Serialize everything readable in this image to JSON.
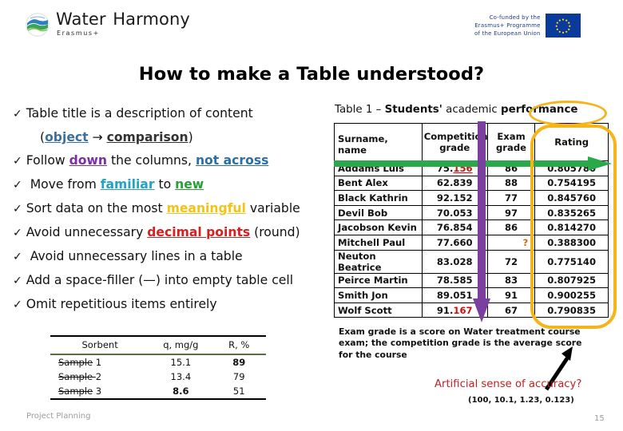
{
  "header": {
    "logo_title_a": "Water",
    "logo_title_b": "Harmony",
    "logo_subtitle": "Erasmus+",
    "eu_line1": "Co-funded by the",
    "eu_line2": "Erasmus+ Programme",
    "eu_line3": "of the European Union"
  },
  "slide": {
    "title": "How to make a Table understood?",
    "footer_label": "Project Planning",
    "page_number": "15"
  },
  "bullets": [
    {
      "check": "✓",
      "pre": "Table title is a description of content"
    },
    {
      "check": "",
      "indent": true,
      "pre": "(",
      "hl1": "object",
      "mid": " → ",
      "hl2": "comparison",
      "post": ")"
    },
    {
      "check": "✓",
      "pre": "Follow ",
      "hl1": "down",
      "mid": " the columns, ",
      "hl2": "not across",
      "post": ""
    },
    {
      "check": "✓",
      "pre": " Move from ",
      "hl1": "familiar",
      "mid": " to ",
      "hl2": "new",
      "post": ""
    },
    {
      "check": "✓",
      "pre": "Sort data on the most ",
      "hl1": "meaningful",
      "mid": "",
      "hl2": "",
      "post": " variable"
    },
    {
      "check": "✓",
      "pre": "Avoid unnecessary ",
      "hl1": "decimal points",
      "mid": "",
      "hl2": "",
      "post": " (round)"
    },
    {
      "check": "✓",
      "pre": " Avoid unnecessary lines in a table"
    },
    {
      "check": "✓",
      "pre": "Add a space-filler (—) into empty table cell"
    },
    {
      "check": "✓",
      "pre": "Omit repetitious items entirely"
    }
  ],
  "mini_table": {
    "columns": [
      "Sorbent",
      "q, mg/g",
      "R, %"
    ],
    "rows": [
      {
        "name_strike": "Sample",
        "name_rest": " 1",
        "q": "15.1",
        "r": "89",
        "q_bold": false,
        "r_bold": true
      },
      {
        "name_strike": "Sample ",
        "name_rest": "2",
        "q": "13.4",
        "r": "79",
        "q_bold": false,
        "r_bold": false
      },
      {
        "name_strike": "Sample",
        "name_rest": " 3",
        "q": "8.6",
        "r": "51",
        "q_bold": true,
        "r_bold": false
      }
    ]
  },
  "main_table": {
    "title_prefix": "Table 1 – ",
    "title_bold": "Students'",
    "title_mid": " academic ",
    "title_circled": "performance",
    "columns": [
      "Surname, name",
      "Competition grade",
      "Exam grade",
      "Rating"
    ],
    "rows": [
      {
        "name": "Addams Luis",
        "comp_int": "75.",
        "comp_dec": "156",
        "comp_red_underline": true,
        "exam": "86",
        "rating": "0.805780",
        "rating_red": false
      },
      {
        "name": "Bent Alex",
        "comp_int": "62.839",
        "comp_dec": "",
        "comp_red_underline": false,
        "exam": "88",
        "rating": "0.754195",
        "rating_red": false
      },
      {
        "name": "Black Kathrin",
        "comp_int": "92.152",
        "comp_dec": "",
        "comp_red_underline": false,
        "exam": "77",
        "rating": "0.845760",
        "rating_red": false
      },
      {
        "name": "Devil Bob",
        "comp_int": "70.053",
        "comp_dec": "",
        "comp_red_underline": false,
        "exam": "97",
        "rating": "0.835265",
        "rating_red": false
      },
      {
        "name": "Jacobson Kevin",
        "comp_int": "76.854",
        "comp_dec": "",
        "comp_red_underline": false,
        "exam": "86",
        "rating": "0.814270",
        "rating_red": false
      },
      {
        "name": "Mitchell Paul",
        "comp_int": "77.660",
        "comp_dec": "",
        "comp_red_underline": false,
        "exam": "?",
        "rating": "0.388300",
        "rating_red": false,
        "exam_missing": true
      },
      {
        "name": "Neuton Beatrice",
        "comp_int": "83.028",
        "comp_dec": "",
        "comp_red_underline": false,
        "exam": "72",
        "rating": "0.775140",
        "rating_red": false
      },
      {
        "name": "Peirce Martin",
        "comp_int": "78.585",
        "comp_dec": "",
        "comp_red_underline": false,
        "exam": "83",
        "rating": "0.807925",
        "rating_red": false
      },
      {
        "name": "Smith Jon",
        "comp_int": "89.051",
        "comp_dec": "",
        "comp_red_underline": false,
        "exam": "91",
        "rating": "0.900255",
        "rating_red": false
      },
      {
        "name": "Wolf Scott",
        "comp_int": "91.",
        "comp_dec": "167",
        "comp_red_underline": false,
        "comp_red": true,
        "exam": "67",
        "rating": "0.790835",
        "rating_red": true
      }
    ],
    "note": "Exam grade is a score on Water treatment course exam; the competition grade is the average score for the course",
    "warning": "Artificial sense of accuracy?",
    "warning_values": "(100, 10.1, 1.23, 0.123)"
  },
  "colors": {
    "green_arrow": "#2aa84a",
    "purple_arrow": "#7b3fa0",
    "yellow_highlight": "#f5b51a",
    "red_warning": "#c02222",
    "eu_blue": "#0a3a9b"
  }
}
